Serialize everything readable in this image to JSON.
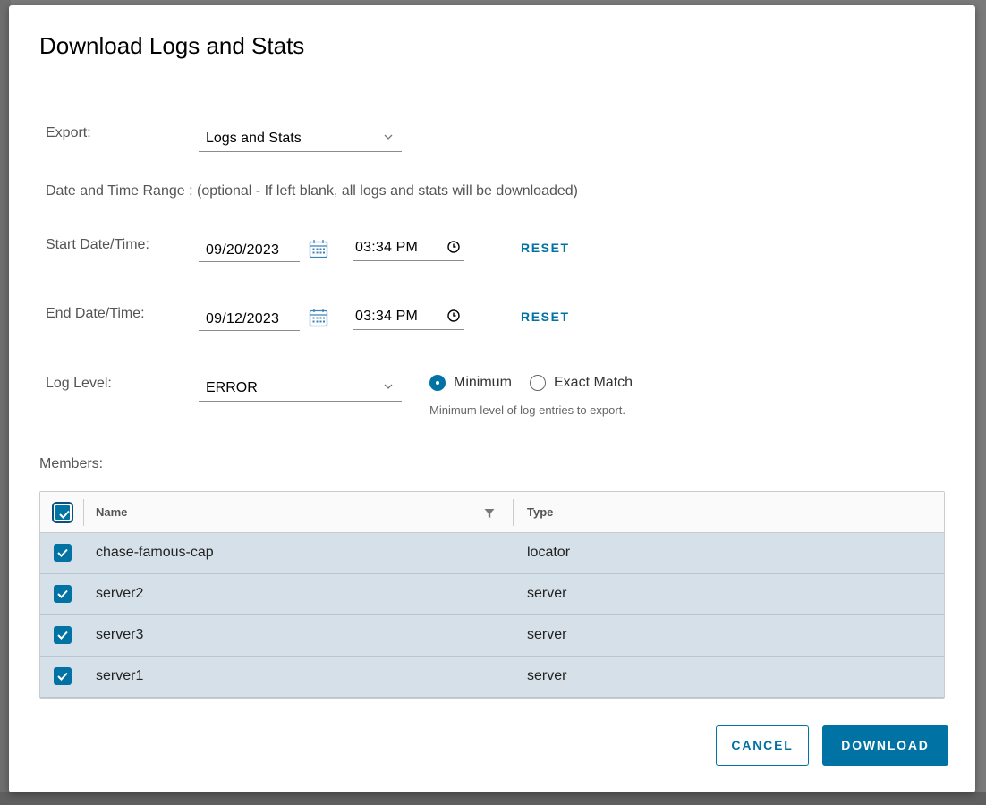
{
  "dialog": {
    "title": "Download Logs and Stats"
  },
  "export": {
    "label": "Export:",
    "value": "Logs and Stats"
  },
  "date_range_note": "Date and Time Range : (optional - If left blank, all logs and stats will be downloaded)",
  "start": {
    "label": "Start Date/Time:",
    "date": "09/20/2023",
    "time": "03:34 PM",
    "reset_label": "RESET"
  },
  "end": {
    "label": "End Date/Time:",
    "date": "09/12/2023",
    "time": "03:34 PM",
    "reset_label": "RESET"
  },
  "log_level": {
    "label": "Log Level:",
    "value": "ERROR",
    "match_options": [
      {
        "label": "Minimum",
        "selected": true
      },
      {
        "label": "Exact Match",
        "selected": false
      }
    ],
    "help": "Minimum level of log entries to export."
  },
  "members": {
    "label": "Members:",
    "columns": {
      "name": "Name",
      "type": "Type"
    },
    "rows": [
      {
        "name": "chase-famous-cap",
        "type": "locator",
        "checked": true
      },
      {
        "name": "server2",
        "type": "server",
        "checked": true
      },
      {
        "name": "server3",
        "type": "server",
        "checked": true
      },
      {
        "name": "server1",
        "type": "server",
        "checked": true
      }
    ]
  },
  "footer": {
    "cancel_label": "CANCEL",
    "download_label": "DOWNLOAD"
  },
  "colors": {
    "accent": "#0072a3",
    "row_selected": "#d5e0e8"
  },
  "icons": [
    "chevron-down-icon",
    "calendar-icon",
    "clock-icon",
    "filter-icon",
    "checkmark-icon"
  ]
}
